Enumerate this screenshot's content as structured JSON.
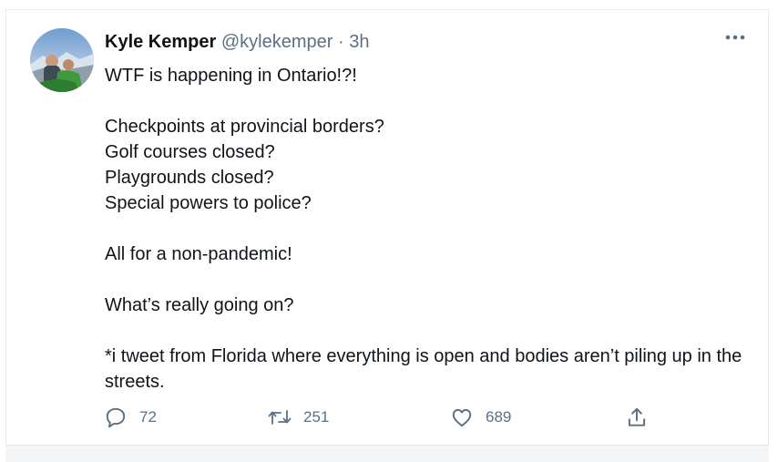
{
  "tweet": {
    "display_name": "Kyle Kemper",
    "handle": "@kylekemper",
    "separator": "·",
    "time": "3h",
    "text_lines": [
      "WTF is happening in Ontario!?!",
      "",
      "Checkpoints at provincial borders?",
      "Golf courses closed?",
      "Playgrounds closed?",
      "Special powers to police?",
      "",
      "All for a non-pandemic!",
      "",
      "What’s really going on?",
      "",
      "*i tweet from Florida where everything is open and bodies aren’t piling up in the streets."
    ],
    "actions": {
      "reply_count": "72",
      "retweet_count": "251",
      "like_count": "689"
    }
  },
  "icons": {
    "more": "more-horizontal-icon",
    "reply": "reply-icon",
    "retweet": "retweet-icon",
    "like": "heart-icon",
    "share": "share-icon"
  },
  "colors": {
    "text": "#0f1419",
    "secondary": "#5b7083",
    "border": "#e6ecf0"
  }
}
